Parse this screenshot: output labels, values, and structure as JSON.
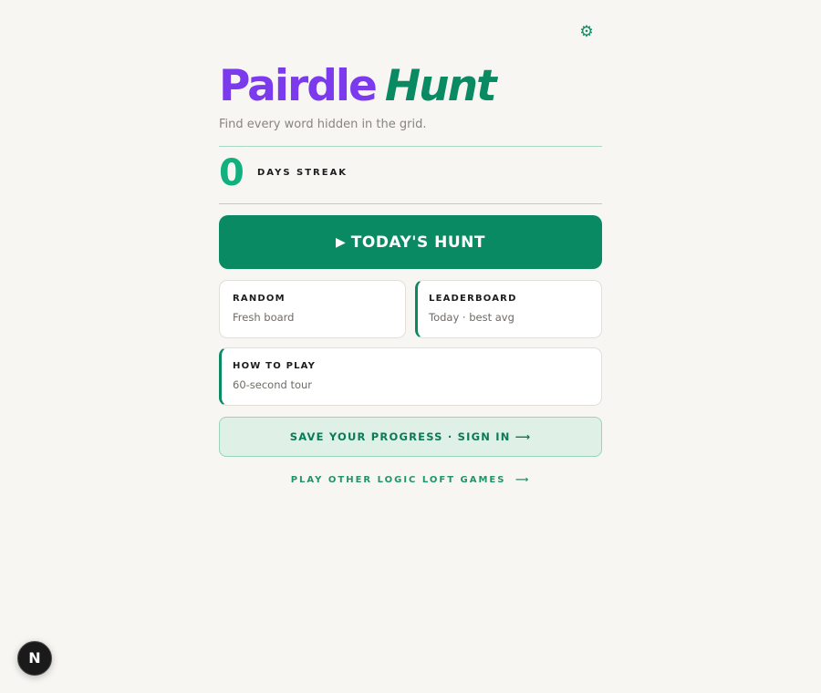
{
  "header": {
    "settings_icon": "gear-icon",
    "settings_glyph": "⚙"
  },
  "hero": {
    "title_part1": "Pairdle",
    "title_part2": "Hunt",
    "tagline": "Find every word hidden in the grid."
  },
  "streak": {
    "count": "0",
    "label": "DAYS STREAK"
  },
  "primary_action": {
    "icon": "play-icon",
    "glyph": "▶",
    "label": "TODAY'S HUNT"
  },
  "cards": [
    {
      "title": "RANDOM",
      "subtitle": "Fresh board"
    },
    {
      "title": "LEADERBOARD",
      "subtitle": "Today · best avg"
    },
    {
      "title": "HOW TO PLAY",
      "subtitle": "60-second tour"
    }
  ],
  "signin": {
    "label": "SAVE YOUR PROGRESS · SIGN IN",
    "arrow": "⟶"
  },
  "other_games": {
    "label": "PLAY OTHER LOGIC LOFT GAMES",
    "arrow": "⟶"
  },
  "dev_badge": {
    "letter": "N",
    "icon": "nextjs-icon"
  },
  "colors": {
    "background": "#f8f6f2",
    "accent_green": "#0a8a62",
    "brand_purple": "#7c3aed",
    "streak_green": "#12b07e"
  }
}
